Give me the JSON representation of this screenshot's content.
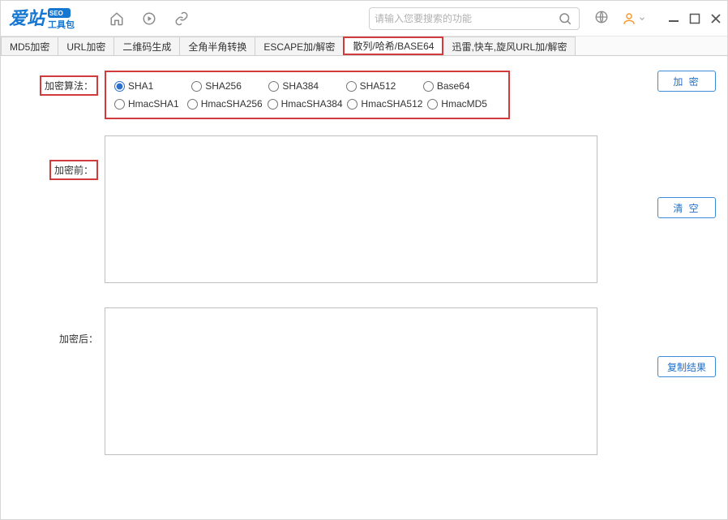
{
  "titlebar": {
    "logo_text1": "爱站",
    "logo_badge": "SEO",
    "logo_text2": "工具包",
    "search_placeholder": "请输入您要搜索的功能"
  },
  "tabs": [
    {
      "label": "MD5加密",
      "active": false
    },
    {
      "label": "URL加密",
      "active": false
    },
    {
      "label": "二维码生成",
      "active": false
    },
    {
      "label": "全角半角转换",
      "active": false
    },
    {
      "label": "ESCAPE加/解密",
      "active": false
    },
    {
      "label": "散列/哈希/BASE64",
      "active": true
    },
    {
      "label": "迅雷,快车,旋风URL加/解密",
      "active": false
    }
  ],
  "labels": {
    "algo": "加密算法：",
    "before": "加密前：",
    "after": "加密后："
  },
  "algorithms_row1": [
    {
      "name": "SHA1",
      "checked": true
    },
    {
      "name": "SHA256",
      "checked": false
    },
    {
      "name": "SHA384",
      "checked": false
    },
    {
      "name": "SHA512",
      "checked": false
    },
    {
      "name": "Base64",
      "checked": false
    }
  ],
  "algorithms_row2": [
    {
      "name": "HmacSHA1",
      "checked": false
    },
    {
      "name": "HmacSHA256",
      "checked": false
    },
    {
      "name": "HmacSHA384",
      "checked": false
    },
    {
      "name": "HmacSHA512",
      "checked": false
    },
    {
      "name": "HmacMD5",
      "checked": false
    }
  ],
  "buttons": {
    "encrypt": "加 密",
    "clear": "清 空",
    "copy": "复制结果"
  },
  "fields": {
    "before_value": "",
    "after_value": ""
  }
}
